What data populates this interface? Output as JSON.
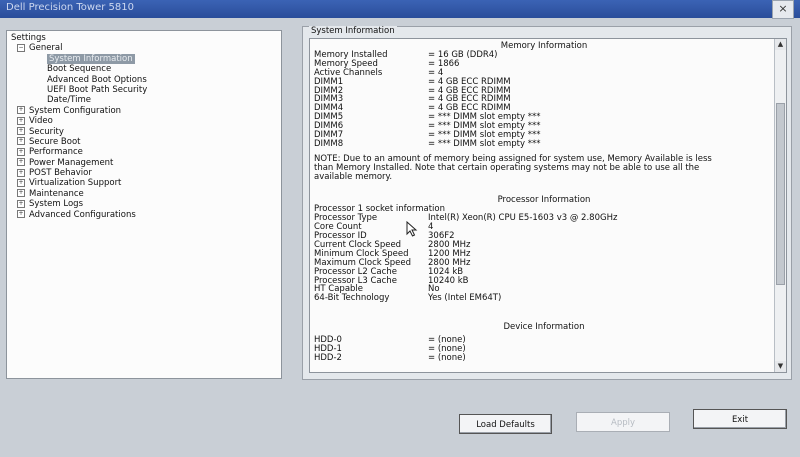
{
  "window": {
    "title": "Dell Precision Tower 5810",
    "close_label": "×"
  },
  "sidebar": {
    "items": [
      {
        "label": "Settings",
        "level": 0,
        "expander": ""
      },
      {
        "label": "General",
        "level": 1,
        "expander": "−"
      },
      {
        "label": "System Information",
        "level": 2,
        "selected": true
      },
      {
        "label": "Boot Sequence",
        "level": 2
      },
      {
        "label": "Advanced Boot Options",
        "level": 2
      },
      {
        "label": "UEFI Boot Path Security",
        "level": 2
      },
      {
        "label": "Date/Time",
        "level": 2
      },
      {
        "label": "System Configuration",
        "level": 1,
        "expander": "+"
      },
      {
        "label": "Video",
        "level": 1,
        "expander": "+"
      },
      {
        "label": "Security",
        "level": 1,
        "expander": "+"
      },
      {
        "label": "Secure Boot",
        "level": 1,
        "expander": "+"
      },
      {
        "label": "Performance",
        "level": 1,
        "expander": "+"
      },
      {
        "label": "Power Management",
        "level": 1,
        "expander": "+"
      },
      {
        "label": "POST Behavior",
        "level": 1,
        "expander": "+"
      },
      {
        "label": "Virtualization Support",
        "level": 1,
        "expander": "+"
      },
      {
        "label": "Maintenance",
        "level": 1,
        "expander": "+"
      },
      {
        "label": "System Logs",
        "level": 1,
        "expander": "+"
      },
      {
        "label": "Advanced Configurations",
        "level": 1,
        "expander": "+"
      }
    ]
  },
  "main": {
    "section_title": "System Information",
    "memory": {
      "heading": "Memory Information",
      "rows": [
        {
          "k": "Memory Installed",
          "v": "= 16 GB (DDR4)"
        },
        {
          "k": "Memory Speed",
          "v": "= 1866"
        },
        {
          "k": "Active Channels",
          "v": "= 4"
        },
        {
          "k": "DIMM1",
          "v": "= 4 GB ECC RDIMM"
        },
        {
          "k": "DIMM2",
          "v": "= 4 GB ECC RDIMM"
        },
        {
          "k": "DIMM3",
          "v": "= 4 GB ECC RDIMM"
        },
        {
          "k": "DIMM4",
          "v": "= 4 GB ECC RDIMM"
        },
        {
          "k": "DIMM5",
          "v": "= *** DIMM slot empty ***"
        },
        {
          "k": "DIMM6",
          "v": "= *** DIMM slot empty ***"
        },
        {
          "k": "DIMM7",
          "v": "= *** DIMM slot empty ***"
        },
        {
          "k": "DIMM8",
          "v": "= *** DIMM slot empty ***"
        }
      ],
      "note": "NOTE: Due to an amount of memory being assigned for system use, Memory Available is less than Memory Installed. Note that certain operating systems may not be able to use all the available memory."
    },
    "processor": {
      "heading": "Processor Information",
      "socket_label": "Processor 1 socket information",
      "rows": [
        {
          "k": "Processor Type",
          "v": "Intel(R) Xeon(R) CPU E5-1603 v3 @ 2.80GHz"
        },
        {
          "k": "Core Count",
          "v": "4"
        },
        {
          "k": "Processor ID",
          "v": "306F2"
        },
        {
          "k": "Current Clock Speed",
          "v": "2800 MHz"
        },
        {
          "k": "Minimum Clock Speed",
          "v": "1200 MHz"
        },
        {
          "k": "Maximum Clock Speed",
          "v": "2800 MHz"
        },
        {
          "k": "Processor L2 Cache",
          "v": "1024 kB"
        },
        {
          "k": "Processor L3 Cache",
          "v": "10240 kB"
        },
        {
          "k": "HT Capable",
          "v": "No"
        },
        {
          "k": "64-Bit Technology",
          "v": "Yes (Intel EM64T)"
        }
      ]
    },
    "device": {
      "heading": "Device Information",
      "rows": [
        {
          "k": "HDD-0",
          "v": "= (none)"
        },
        {
          "k": "HDD-1",
          "v": "= (none)"
        },
        {
          "k": "HDD-2",
          "v": "= (none)"
        }
      ]
    }
  },
  "buttons": {
    "load_defaults": "Load Defaults",
    "apply": "Apply",
    "exit": "Exit"
  },
  "icons": {
    "scroll_up": "▲",
    "scroll_down": "▼"
  }
}
